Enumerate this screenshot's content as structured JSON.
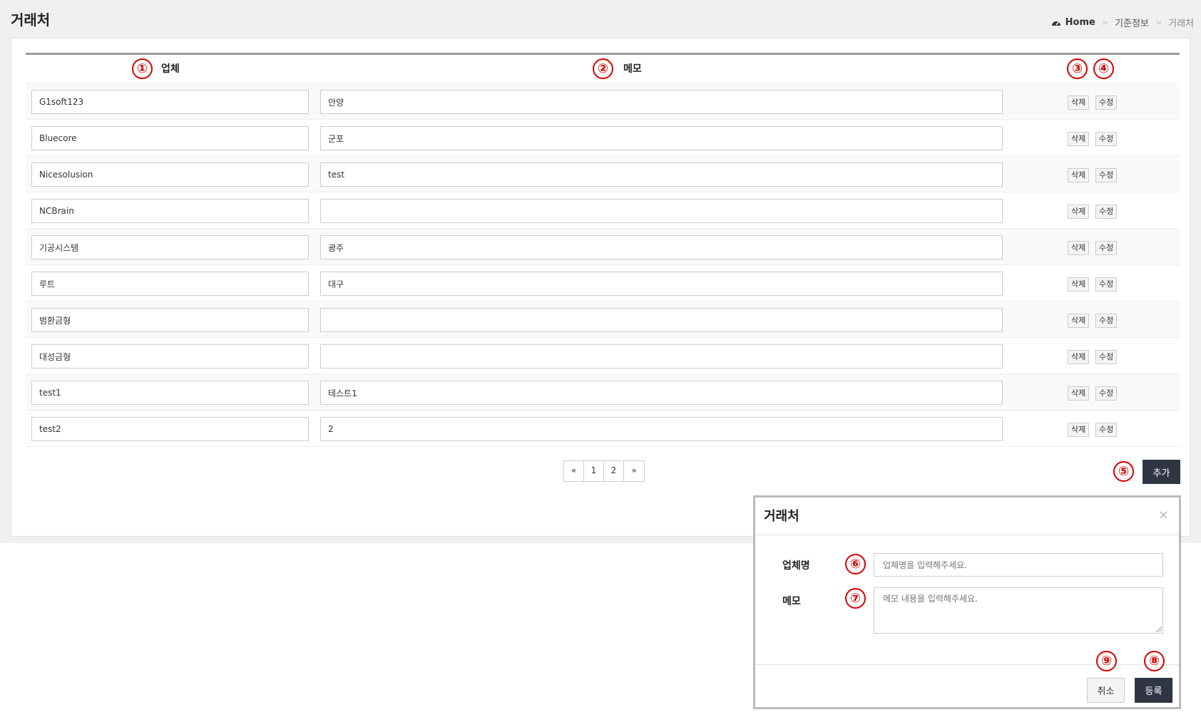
{
  "page": {
    "title": "거래처"
  },
  "breadcrumb": {
    "home": "Home",
    "sep": ">",
    "parent": "기준정보",
    "current": "거래처"
  },
  "table": {
    "headers": {
      "company": "업체",
      "memo": "메모"
    },
    "rows": [
      {
        "company": "G1soft123",
        "memo": "안양"
      },
      {
        "company": "Bluecore",
        "memo": "군포"
      },
      {
        "company": "Nicesolusion",
        "memo": "test"
      },
      {
        "company": "NCBrain",
        "memo": ""
      },
      {
        "company": "기공시스템",
        "memo": "광주"
      },
      {
        "company": "루트",
        "memo": "대구"
      },
      {
        "company": "범환금형",
        "memo": ""
      },
      {
        "company": "대성금형",
        "memo": ""
      },
      {
        "company": "test1",
        "memo": "테스트1"
      },
      {
        "company": "test2",
        "memo": "2"
      }
    ],
    "delete_label": "삭제",
    "edit_label": "수정"
  },
  "add_button": "추가",
  "pagination": {
    "prev": "«",
    "pages": [
      "1",
      "2"
    ],
    "next": "»"
  },
  "modal": {
    "title": "거래처",
    "close": "×",
    "company_label": "업체명",
    "company_placeholder": "업체명을 입력해주세요.",
    "memo_label": "메모",
    "memo_placeholder": "메모 내용을 입력해주세요.",
    "cancel": "취소",
    "submit": "등록"
  },
  "callouts": [
    "①",
    "②",
    "③",
    "④",
    "⑤",
    "⑥",
    "⑦",
    "⑧",
    "⑨"
  ],
  "colors": {
    "accent_dark": "#2f3542",
    "callout_red": "#d60000",
    "background": "#f0f0f0"
  }
}
